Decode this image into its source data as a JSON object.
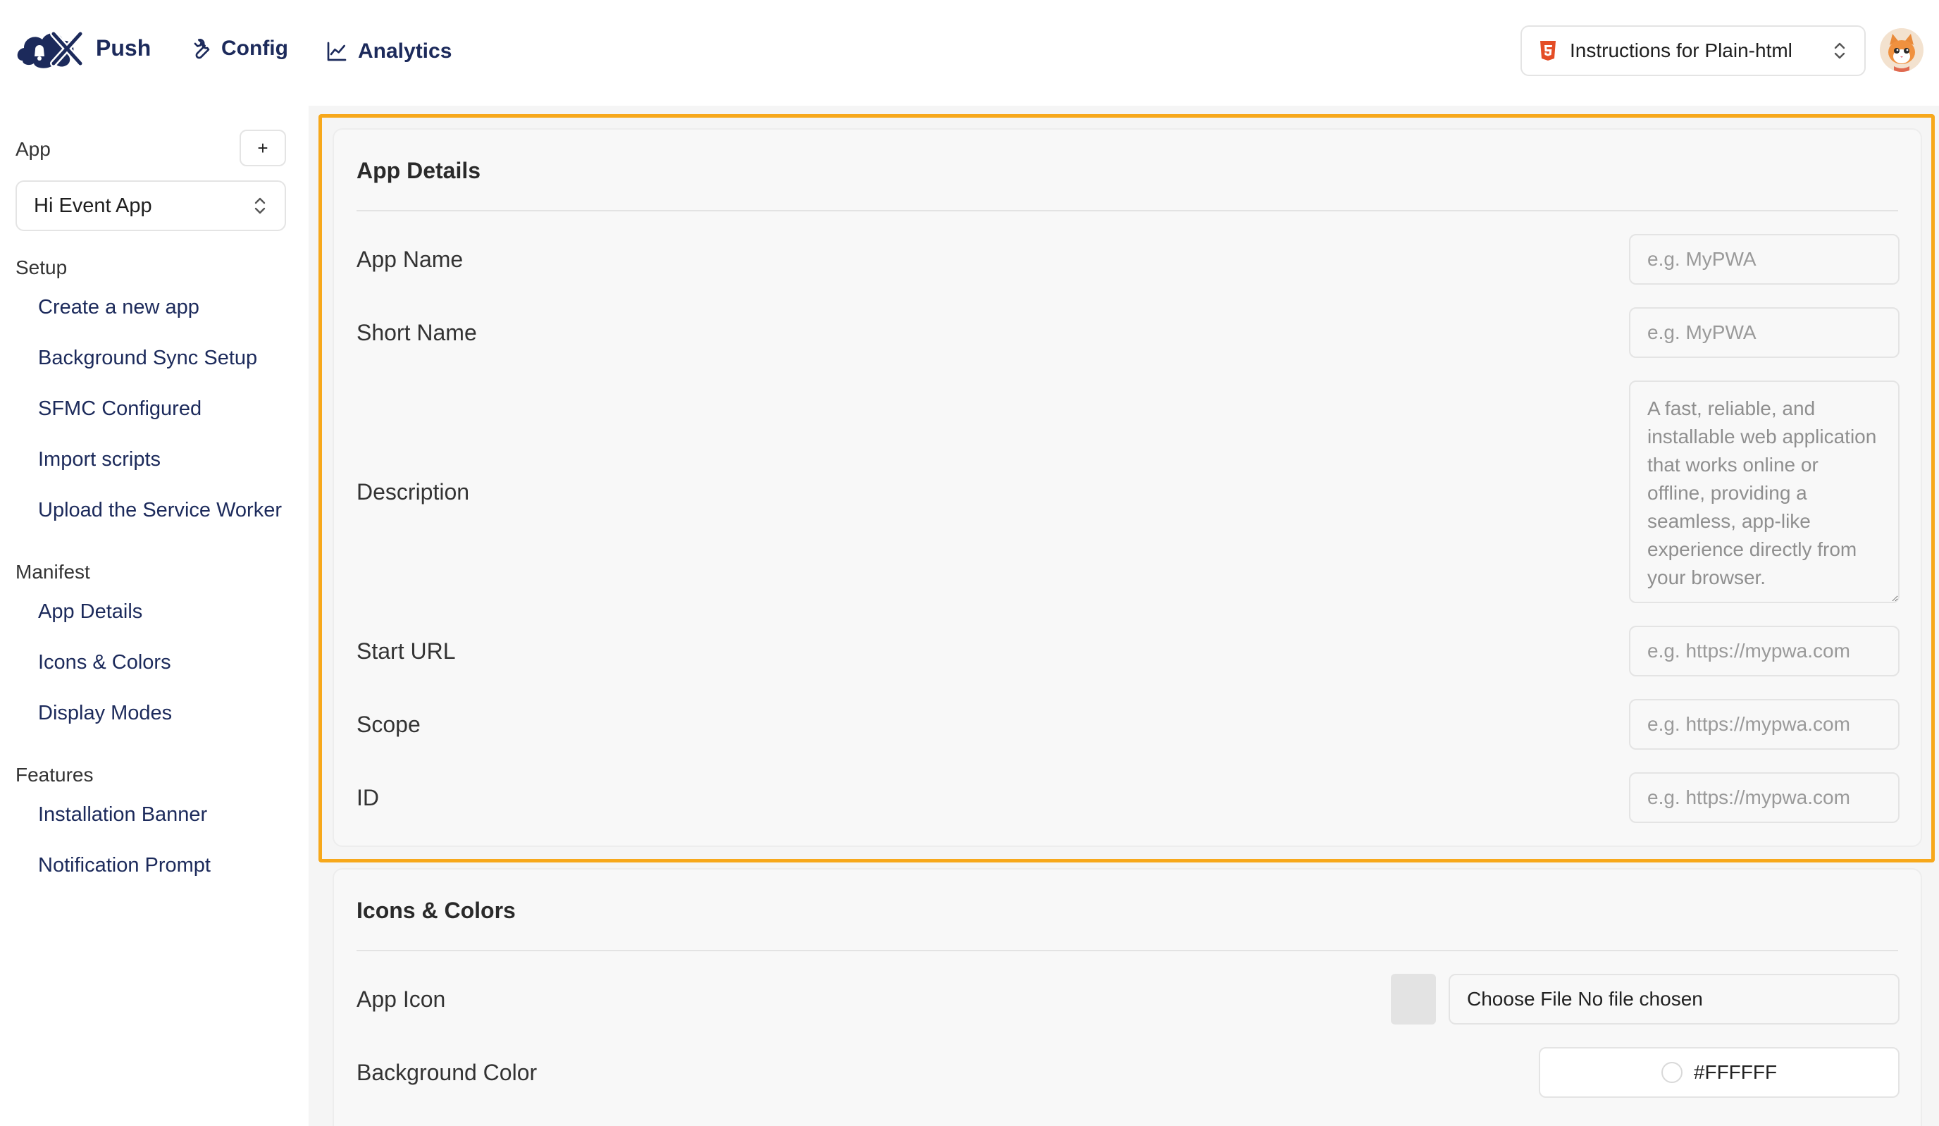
{
  "header": {
    "brand": "Push",
    "nav": [
      {
        "label": "Config",
        "icon": "wrench-icon"
      },
      {
        "label": "Analytics",
        "icon": "line-chart-icon"
      }
    ],
    "instructions_select": {
      "label": "Instructions for Plain-html",
      "icon": "html5-icon"
    },
    "colors": {
      "brand": "#1c2a5b",
      "highlight": "#f7a81b",
      "html5": "#e44d26"
    }
  },
  "sidebar": {
    "app_section": "App",
    "add_label": "+",
    "app_selected": "Hi Event App",
    "groups": [
      {
        "title": "Setup",
        "items": [
          "Create a new app",
          "Background Sync Setup",
          "SFMC Configured",
          "Import scripts",
          "Upload the Service Worker"
        ]
      },
      {
        "title": "Manifest",
        "items": [
          "App Details",
          "Icons & Colors",
          "Display Modes"
        ]
      },
      {
        "title": "Features",
        "items": [
          "Installation Banner",
          "Notification Prompt"
        ]
      }
    ]
  },
  "app_details": {
    "title": "App Details",
    "fields": {
      "app_name": {
        "label": "App Name",
        "placeholder": "e.g. MyPWA"
      },
      "short_name": {
        "label": "Short Name",
        "placeholder": "e.g. MyPWA"
      },
      "description": {
        "label": "Description",
        "placeholder": "A fast, reliable, and installable web application that works online or offline, providing a seamless, app-like experience directly from your browser."
      },
      "start_url": {
        "label": "Start URL",
        "placeholder": "e.g. https://mypwa.com"
      },
      "scope": {
        "label": "Scope",
        "placeholder": "e.g. https://mypwa.com"
      },
      "id": {
        "label": "ID",
        "placeholder": "e.g. https://mypwa.com"
      }
    }
  },
  "icons_colors": {
    "title": "Icons & Colors",
    "app_icon": {
      "label": "App Icon",
      "button": "Choose File",
      "status": "No file chosen"
    },
    "background_color": {
      "label": "Background Color",
      "value": "#FFFFFF"
    }
  }
}
